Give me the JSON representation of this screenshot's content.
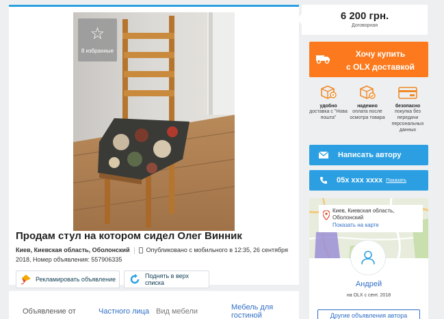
{
  "listing": {
    "favorites_label": "8 избранные",
    "title": "Продам стул на котором сидел Олег Винник",
    "location": "Киев, Киевская область, Оболонский",
    "published": "Опубликовано с мобильного  в 12:35, 26 сентября",
    "ad_number": "2018, Номер объявления: 557906335",
    "promote_label": "Рекламировать объявление",
    "raise_label": "Поднять в верх списка"
  },
  "details": {
    "offer_from_key": "Объявление от",
    "offer_from_value": "Частного лица",
    "furniture_key": "Вид мебели",
    "furniture_value": "Мебель для гостиной"
  },
  "sidebar": {
    "price": "6 200 грн.",
    "negotiable": "Договорная",
    "buy_line1": "Хочу купить",
    "buy_line2": "с OLX доставкой",
    "features": [
      {
        "title": "удобно",
        "text": "доставка с \"Нова пошта\"",
        "icon": "box-location-icon"
      },
      {
        "title": "надежно",
        "text": "оплата после осмотра товара",
        "icon": "box-check-icon"
      },
      {
        "title": "безопасно",
        "text": "покупка без передачи персональных данных",
        "icon": "card-icon"
      }
    ],
    "write_label": "Написать автору",
    "phone": "05x xxx xxxx",
    "show_label": "Показать",
    "map_address": "Киев, Киевская область, Оболонский",
    "show_on_map": "Показать на карте",
    "user_name": "Андрей",
    "member_since": "на OLX с сент. 2018",
    "other_ads": "Другие объявления автора"
  },
  "colors": {
    "accent_blue": "#2b9fe1",
    "orange": "#fc7a1d",
    "link": "#2f6ec5",
    "background": "#edeff1"
  }
}
